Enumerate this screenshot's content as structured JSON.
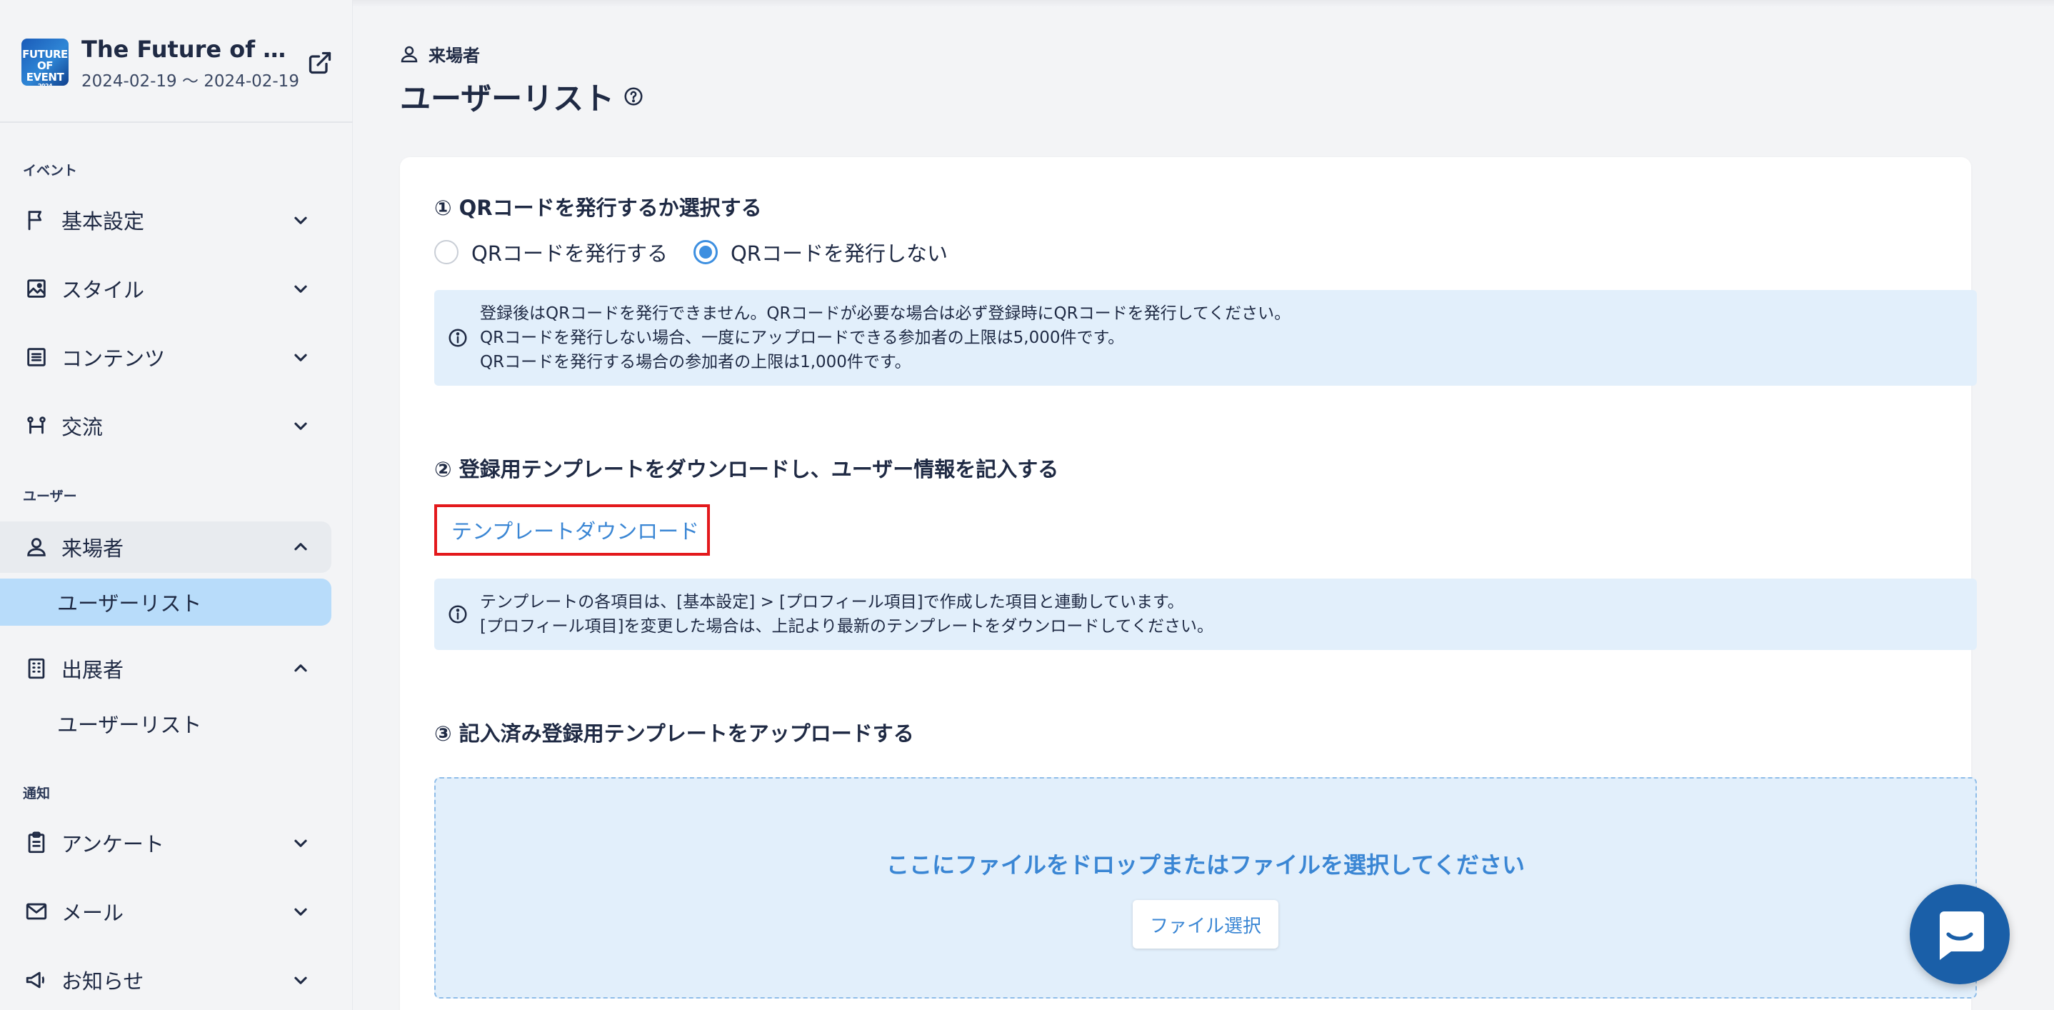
{
  "event": {
    "logo_lines": [
      "FUTURE",
      "OF EVENT",
      "2024"
    ],
    "title": "The Future of Eve…",
    "dates": "2024-02-19 〜 2024-02-19"
  },
  "sidebar": {
    "sections": {
      "event": "イベント",
      "user": "ユーザー",
      "notify": "通知"
    },
    "items": {
      "basic": "基本設定",
      "style": "スタイル",
      "contents": "コンテンツ",
      "exchange": "交流",
      "visitor": "来場者",
      "visitor_userlist": "ユーザーリスト",
      "exhibitor": "出展者",
      "exhibitor_userlist": "ユーザーリスト",
      "survey": "アンケート",
      "mail": "メール",
      "news": "お知らせ"
    }
  },
  "page": {
    "breadcrumb": "来場者",
    "title": "ユーザーリスト"
  },
  "step1": {
    "title": "① QRコードを発行するか選択する",
    "option_issue": "QRコードを発行する",
    "option_no_issue": "QRコードを発行しない",
    "selected": "option_no_issue",
    "info": [
      "登録後はQRコードを発行できません。QRコードが必要な場合は必ず登録時にQRコードを発行してください。",
      "QRコードを発行しない場合、一度にアップロードできる参加者の上限は5,000件です。",
      "QRコードを発行する場合の参加者の上限は1,000件です。"
    ]
  },
  "step2": {
    "title": "② 登録用テンプレートをダウンロードし、ユーザー情報を記入する",
    "download_link": "テンプレートダウンロード",
    "info": [
      "テンプレートの各項目は、[基本設定] > [プロフィール項目]で作成した項目と連動しています。",
      "[プロフィール項目]を変更した場合は、上記より最新のテンプレートをダウンロードしてください。"
    ]
  },
  "step3": {
    "title": "③ 記入済み登録用テンプレートをアップロードする",
    "dropzone_text": "ここにファイルをドロップまたはファイルを選択してください",
    "file_button": "ファイル選択"
  },
  "colors": {
    "accent": "#3a86d4",
    "active_nav": "#b8dcfa",
    "info_bg": "#e2effb",
    "highlight": "#e3191c",
    "chat": "#1a5fa8"
  }
}
